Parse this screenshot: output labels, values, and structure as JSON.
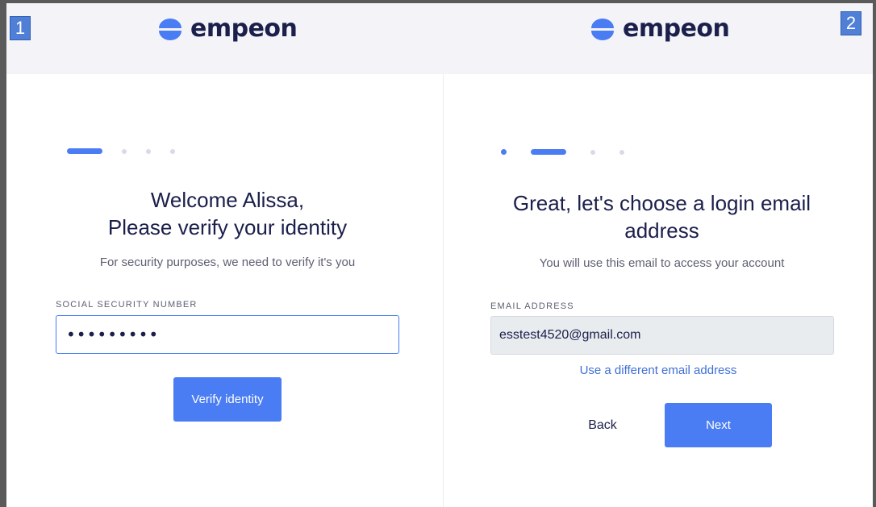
{
  "colors": {
    "brand_blue": "#4a7cf3",
    "navy_text": "#1b1f4b",
    "muted_text": "#5d6072",
    "badge_blue": "#4f7fd6",
    "topbar_bg": "#f4f4f8"
  },
  "badges": {
    "step1": "1",
    "step2": "2"
  },
  "logo": {
    "text": "empeon",
    "icon": "empeon-logo-icon"
  },
  "panel1": {
    "progress": {
      "steps": 4,
      "current": 1
    },
    "title_line1": "Welcome Alissa,",
    "title_line2": "Please verify your identity",
    "subtitle": "For security purposes, we need to verify it's you",
    "field_label": "SOCIAL SECURITY NUMBER",
    "field_value": "•••••••••",
    "button_label": "Verify identity"
  },
  "panel2": {
    "progress": {
      "steps": 4,
      "current": 2
    },
    "title_line1": "Great, let's choose a login email",
    "title_line2": "address",
    "subtitle": "You will use this email to access your account",
    "field_label": "EMAIL ADDRESS",
    "field_value": "esstest4520@gmail.com",
    "link_label": "Use a different email address",
    "back_label": "Back",
    "next_label": "Next"
  }
}
